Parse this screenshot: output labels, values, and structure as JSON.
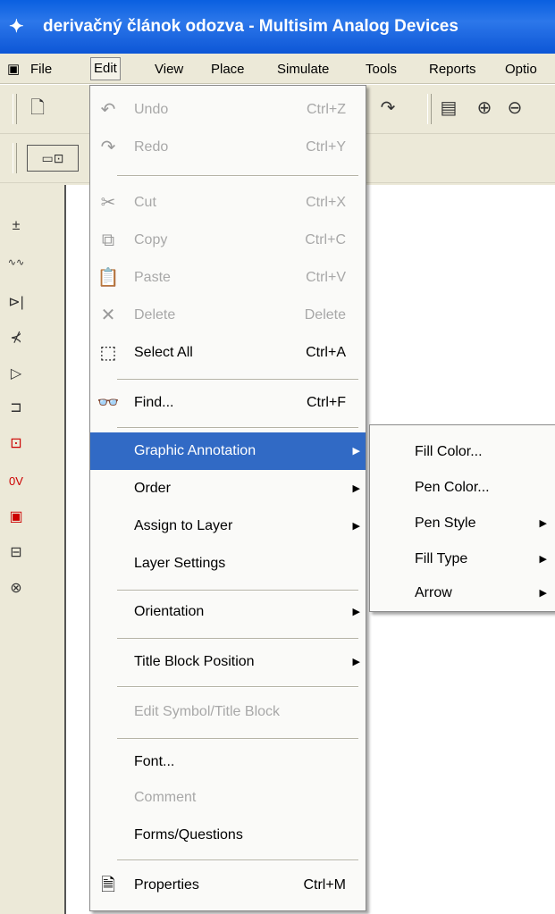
{
  "window": {
    "title": "derivačný článok odozva - Multisim Analog Devices",
    "title_icon": "multisim-logo-icon"
  },
  "menubar": {
    "items": [
      "File",
      "Edit",
      "View",
      "Place",
      "Simulate",
      "Tools",
      "Reports",
      "Optio"
    ],
    "active": "Edit"
  },
  "toolbar": {
    "icons": [
      "new-icon",
      "open-icon",
      "redo-icon",
      "netlist-icon",
      "zoom-in-icon",
      "zoom-out-icon",
      "component-icon"
    ]
  },
  "left_panel": {
    "icons": [
      "source-icon",
      "resistor-icon",
      "diode-icon",
      "transistor-icon",
      "opamp-icon",
      "ttl-icon",
      "cmos-icon",
      "misc-digital-icon",
      "mixed-icon",
      "indicator-icon",
      "electromech-icon"
    ]
  },
  "edit_menu": {
    "undo": {
      "label": "Undo",
      "shortcut": "Ctrl+Z"
    },
    "redo": {
      "label": "Redo",
      "shortcut": "Ctrl+Y"
    },
    "cut": {
      "label": "Cut",
      "shortcut": "Ctrl+X"
    },
    "copy": {
      "label": "Copy",
      "shortcut": "Ctrl+C"
    },
    "paste": {
      "label": "Paste",
      "shortcut": "Ctrl+V"
    },
    "delete": {
      "label": "Delete",
      "shortcut": "Delete"
    },
    "select_all": {
      "label": "Select All",
      "shortcut": "Ctrl+A"
    },
    "find": {
      "label": "Find...",
      "shortcut": "Ctrl+F"
    },
    "graphic_annotation": {
      "label": "Graphic Annotation"
    },
    "order": {
      "label": "Order"
    },
    "assign_to_layer": {
      "label": "Assign to Layer"
    },
    "layer_settings": {
      "label": "Layer Settings"
    },
    "orientation": {
      "label": "Orientation"
    },
    "title_block_position": {
      "label": "Title Block Position"
    },
    "edit_symbol": {
      "label": "Edit Symbol/Title Block"
    },
    "font": {
      "label": "Font..."
    },
    "comment": {
      "label": "Comment"
    },
    "forms_questions": {
      "label": "Forms/Questions"
    },
    "properties": {
      "label": "Properties",
      "shortcut": "Ctrl+M"
    }
  },
  "submenu": {
    "fill_color": "Fill Color...",
    "pen_color": "Pen Color...",
    "pen_style": "Pen Style",
    "fill_type": "Fill Type",
    "arrow": "Arrow"
  },
  "colors": {
    "highlight": "#316ac5",
    "titlebar": "#0a5fe0",
    "menu_bg": "#ece9d8",
    "disabled_text": "#a8a8a8"
  }
}
